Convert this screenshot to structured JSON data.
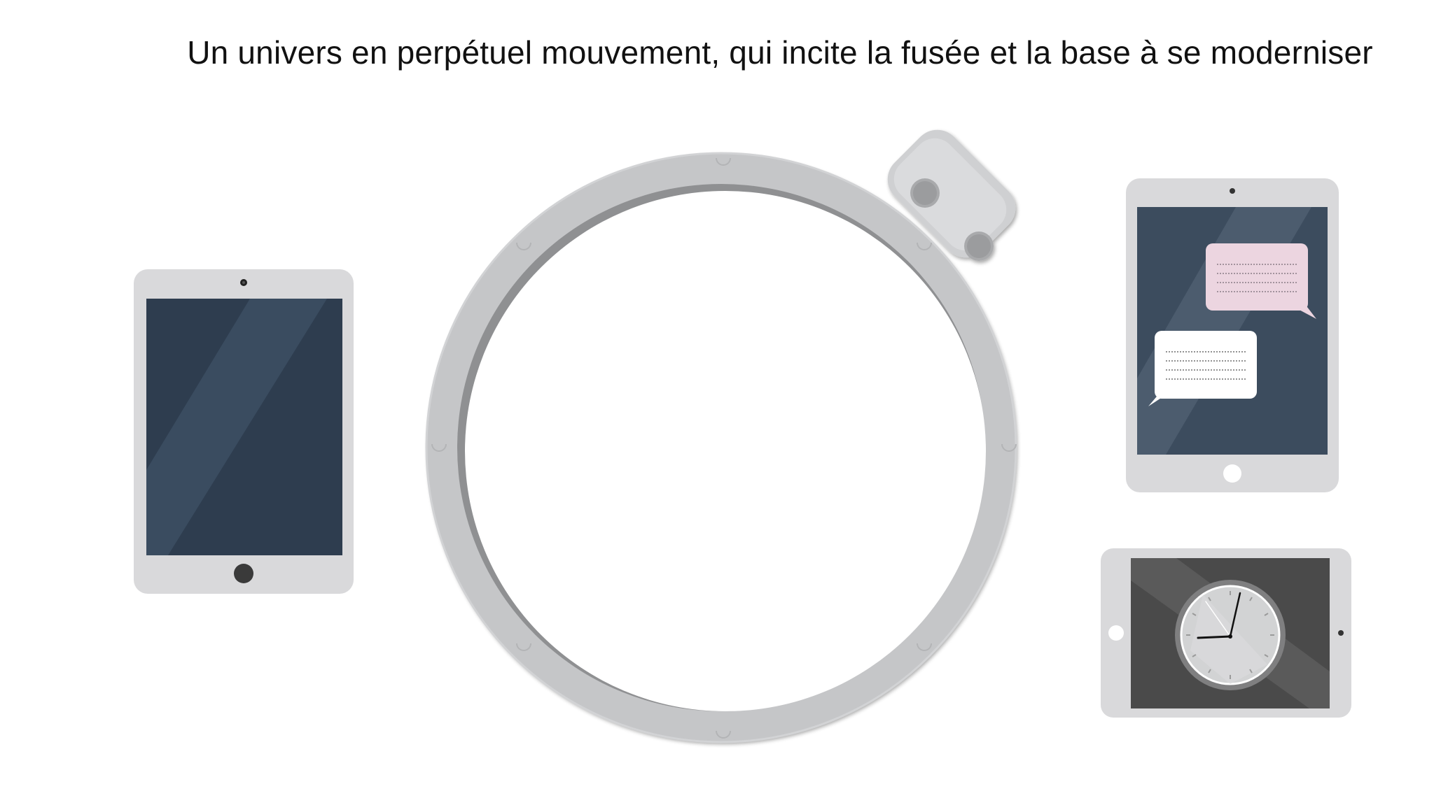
{
  "headline": "Un univers en perpétuel mouvement, qui incite la fusée et la base à se moderniser",
  "colors": {
    "background": "#ffffff",
    "device_body": "#d9d9db",
    "porthole_ring": "#c5c6c8",
    "screen_navy": "#2e3d4f",
    "screen_slate": "#3c4c5e",
    "screen_charcoal": "#4a4a4a",
    "bubble_pink": "#ecd5e0",
    "bubble_white": "#ffffff",
    "clock_face": "#d2d3d4"
  },
  "scene": {
    "left_tablet": {
      "icon": "tablet-portrait-icon"
    },
    "porthole": {
      "icon": "porthole-icon",
      "hinge_icon": "hinge-icon"
    },
    "chat_tablet": {
      "icon": "tablet-chat-icon",
      "bubbles": [
        "pink-message-bubble",
        "white-message-bubble"
      ]
    },
    "clock_tablet": {
      "icon": "tablet-landscape-clock-icon",
      "clock": {
        "hour_hand_angle_deg": 268,
        "minute_hand_angle_deg": 12
      }
    }
  }
}
